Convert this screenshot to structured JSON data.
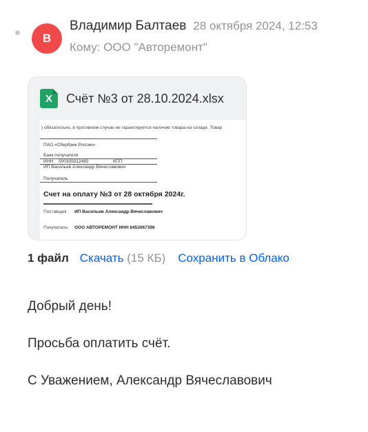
{
  "message": {
    "sender": {
      "avatar_letter": "В",
      "avatar_color": "#f0494a",
      "name": "Владимир Балтаев"
    },
    "date": "28 октября 2024, 12:53",
    "recipient": "Кому: ООО \"Авторемонт\""
  },
  "attachment": {
    "icon": "xlsx-file-icon",
    "icon_letter": "X",
    "file_name": "Счёт №3 от 28.10.2024.xlsx",
    "preview": {
      "warning": ") обязательно, в противном случае не гарантируется наличие товара на складе. Товар",
      "bank_name": "ПАО «Сбербанк России»",
      "bank_label": "Банк получателя",
      "inn_label": "ИНН",
      "inn_value": "500305012460",
      "kpp_label": "КПП",
      "recipient_name": "ИП Васильев Александр Вячеславович",
      "recipient_label": "Получатель",
      "invoice_title": "Счет на оплату №3 от 28 октября 2024г.",
      "supplier_label": "Поставщик:",
      "supplier_value": "ИП Васильев Александр Вячеславович",
      "buyer_label": "Покупатель:",
      "buyer_value": "ООО АВТОРЕМОНТ ИНН 6453067396"
    }
  },
  "files_bar": {
    "count_label": "1 файл",
    "download_label": "Скачать",
    "size_label": "(15 КБ)",
    "save_cloud_label": "Сохранить в Облако"
  },
  "body": {
    "greeting": "Добрый день!",
    "request": "Просьба оплатить счёт.",
    "signature": "С Уважением, Александр Вячеславович"
  },
  "colors": {
    "link": "#005ff9",
    "muted": "#919399",
    "text": "#2c2d2e",
    "excel_green": "#21a366"
  }
}
